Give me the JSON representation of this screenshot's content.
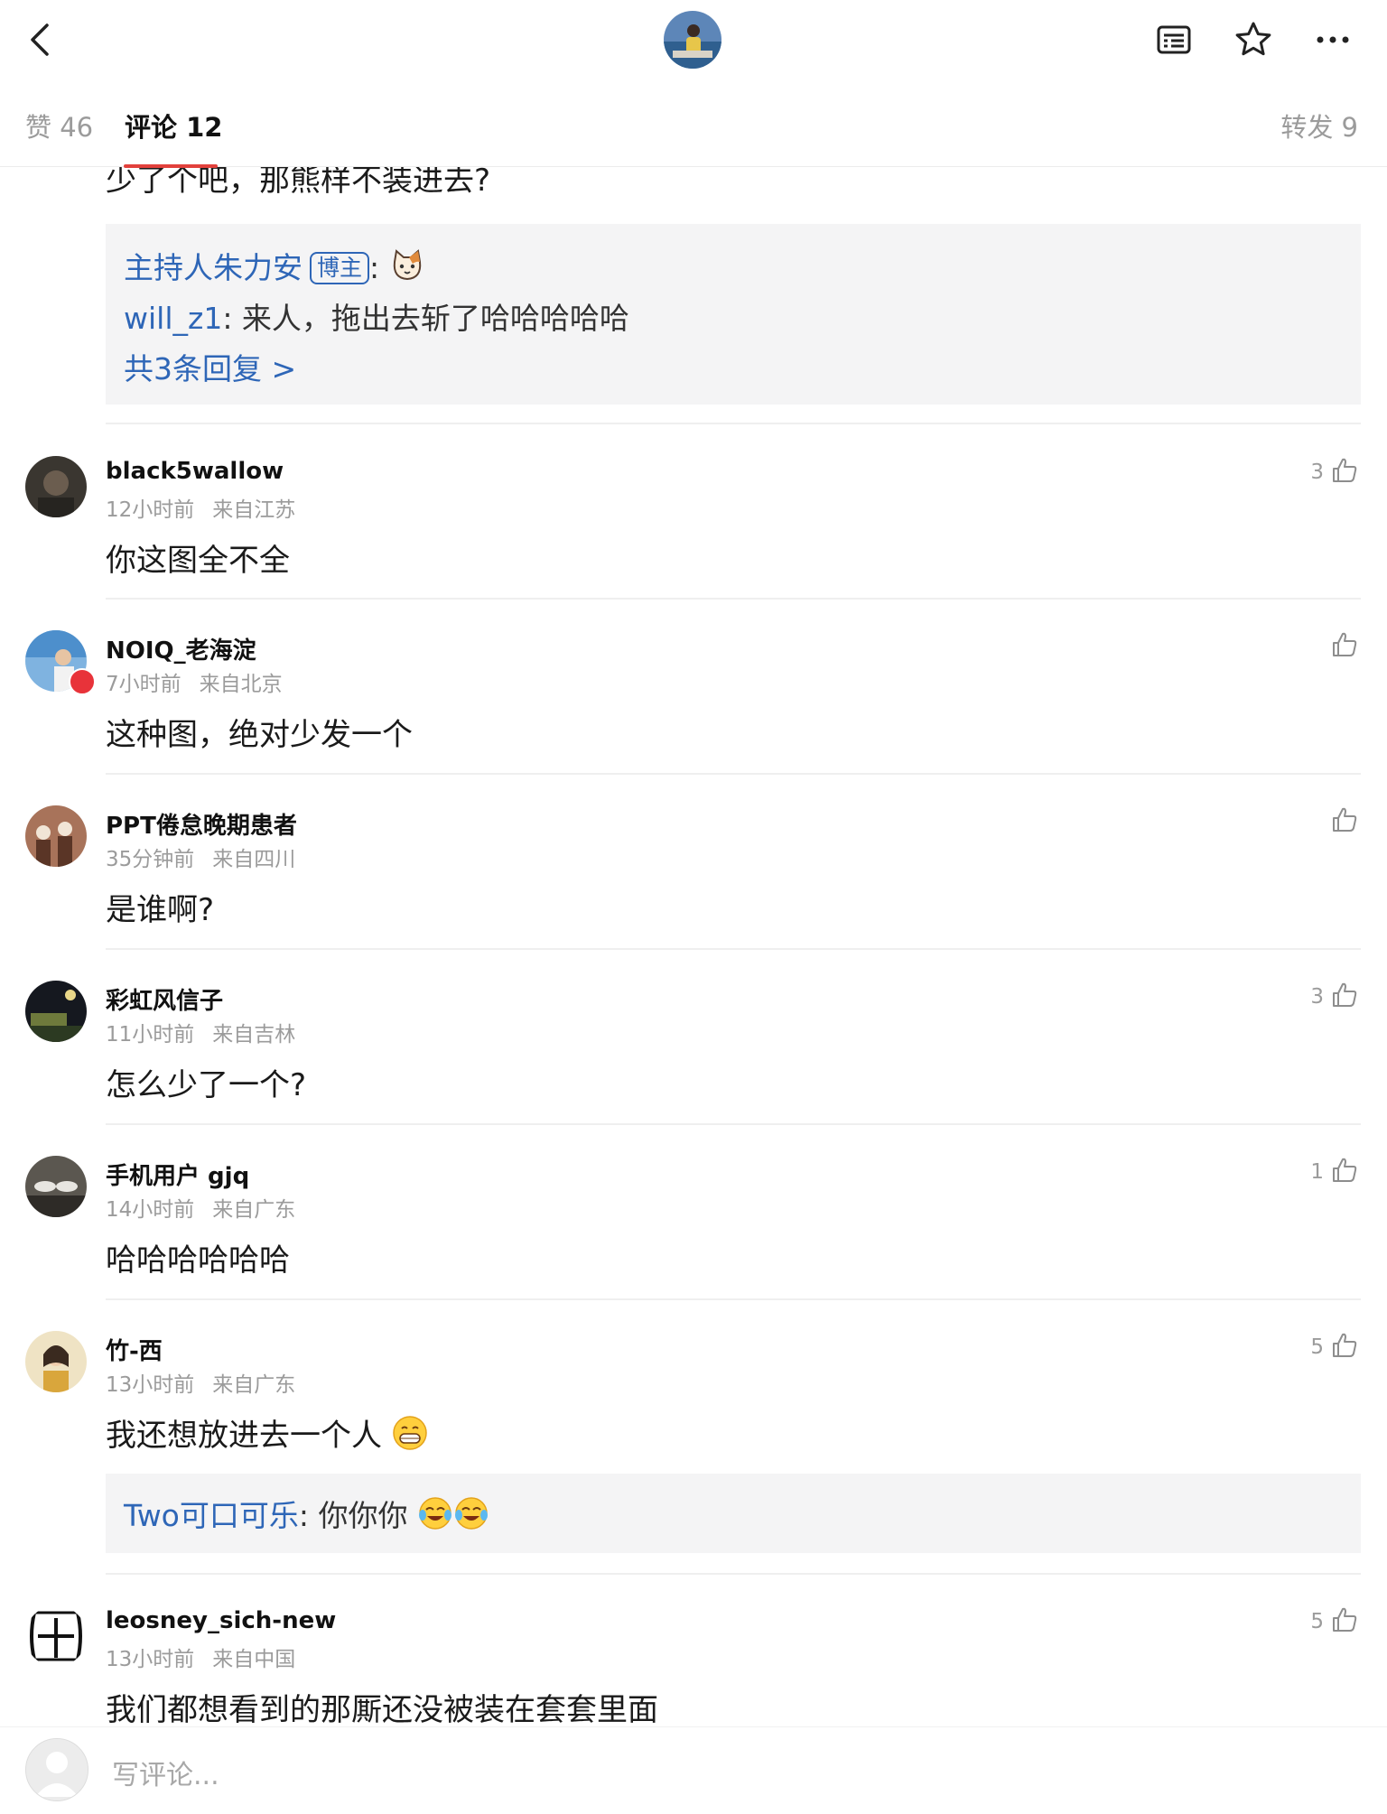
{
  "header": {
    "icons": [
      "back-icon",
      "article-icon",
      "star-icon",
      "more-icon"
    ]
  },
  "tabs": {
    "likes": "赞 46",
    "comments": "评论 12",
    "reposts": "转发 9"
  },
  "partial_comment": {
    "text": "少了个吧，那熊样不装进去?",
    "replies": [
      {
        "user": "主持人朱力安",
        "badge": "博主",
        "sep": ":",
        "text": ""
      },
      {
        "user": "will_z1",
        "sep": ": ",
        "text": "来人，拖出去斩了哈哈哈哈哈"
      }
    ],
    "more_replies": "共3条回复 >"
  },
  "comments": [
    {
      "name": "black5wallow",
      "time": "12小时前",
      "location": "来自江苏",
      "text": "你这图全不全",
      "likes": "3"
    },
    {
      "name": "NOIQ_老海淀",
      "time": "7小时前",
      "location": "来自北京",
      "text": "这种图，绝对少发一个",
      "likes": ""
    },
    {
      "name": "PPT倦怠晚期患者",
      "time": "35分钟前",
      "location": "来自四川",
      "text": "是谁啊?",
      "likes": ""
    },
    {
      "name": "彩虹风信子",
      "time": "11小时前",
      "location": "来自吉林",
      "text": "怎么少了一个?",
      "likes": "3"
    },
    {
      "name": "手机用户 gjq",
      "time": "14小时前",
      "location": "来自广东",
      "text": "哈哈哈哈哈哈",
      "likes": "1"
    },
    {
      "name": "竹-西",
      "time": "13小时前",
      "location": "来自广东",
      "text": "我还想放进去一个人",
      "likes": "5",
      "reply": {
        "user": "Two可口可乐",
        "sep": ": ",
        "text": "你你你"
      }
    },
    {
      "name": "leosney_sich-new",
      "time": "13小时前",
      "location": "来自中国",
      "text": "我们都想看到的那厮还没被装在套套里面",
      "likes": "5"
    }
  ],
  "composer": {
    "placeholder": "写评论..."
  },
  "colors": {
    "accent": "#e2413c",
    "link": "#2e66b7",
    "muted": "#9b9b9b"
  }
}
